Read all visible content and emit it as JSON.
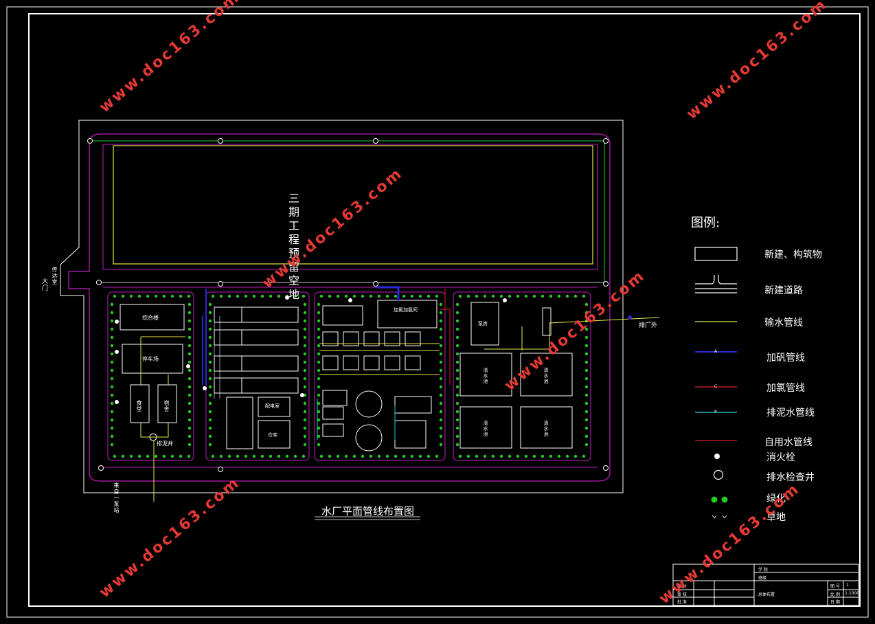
{
  "drawing": {
    "title": "水厂平面管线布置图",
    "reserve_area_label": "三期工程预留空地",
    "gate_label": "大门",
    "guard_label": "传达室",
    "outlet_label": "排厂外",
    "intake_label": "来自一泵站"
  },
  "buildings": {
    "office": "综合楼",
    "garage": "停车场",
    "canteen": "食堂",
    "dorm": "宿舍",
    "sludge_well": "排泥井",
    "substation": "配电室",
    "storage": "仓库",
    "chlorination": "加氯加氨间",
    "pump_house": "泵房",
    "clear_well_1": "清水池",
    "clear_well_2": "清水池",
    "clear_well_3": "清水池",
    "clear_well_4": "清水池"
  },
  "legend": {
    "title": "图例:",
    "items": [
      {
        "label": "新建、构筑物",
        "symbol": "rect",
        "color": "#ffffff"
      },
      {
        "label": "新建道路",
        "symbol": "road",
        "color": "#ffffff"
      },
      {
        "label": "输水管线",
        "symbol": "line",
        "color": "#e8e84a"
      },
      {
        "label": "加矾管线",
        "symbol": "line",
        "color": "#2a2ad8",
        "code": "A"
      },
      {
        "label": "加氯管线",
        "symbol": "line",
        "color": "#e02020",
        "code": "C"
      },
      {
        "label": "排泥水管线",
        "symbol": "line",
        "color": "#20d0d0",
        "code": "P"
      },
      {
        "label": "自用水管线",
        "symbol": "line",
        "color": "#e02020"
      },
      {
        "label": "消火栓",
        "symbol": "hydrant",
        "color": "#ffffff"
      },
      {
        "label": "排水检查井",
        "symbol": "manhole",
        "color": "#ffffff"
      },
      {
        "label": "绿化",
        "symbol": "green",
        "color": "#22cc22"
      },
      {
        "label": "草地",
        "symbol": "grass",
        "color": "#ffffff"
      }
    ]
  },
  "title_block": {
    "row1": "学 院",
    "row2": "班级",
    "design": "设 计",
    "check": "审 核",
    "approve": "批 准",
    "drawing_name": "总体布置",
    "sheet_label": "图 号",
    "sheet_no": "1",
    "scale_label": "比 例",
    "scale": "1:1000",
    "date_label": "日 期"
  },
  "watermark": "www.doc163.com",
  "colors": {
    "frame": "#ffffff",
    "road": "#c020c0",
    "water_pipe": "#e8e84a",
    "alum_pipe": "#2a2ad8",
    "chlorine_pipe": "#e02020",
    "sludge_pipe": "#20d0d0",
    "green": "#22cc22",
    "watermark": "#e53935"
  }
}
